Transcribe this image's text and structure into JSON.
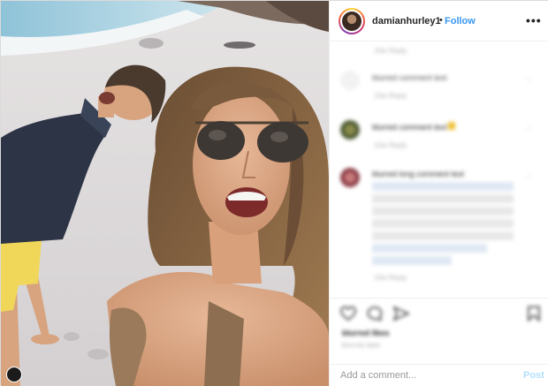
{
  "post": {
    "username": "damianhurley1",
    "separator": "•",
    "follow_label": "Follow",
    "more_label": "•••"
  },
  "comments": [
    {
      "text": "",
      "meta": "10w  Reply"
    },
    {
      "text": "blurred comment text",
      "meta": "10w  Reply"
    },
    {
      "text": "blurred comment text",
      "meta": "10w  Reply"
    },
    {
      "text": "blurred long comment text",
      "meta": "10w  Reply"
    }
  ],
  "actions": {
    "likes": "blurred likes",
    "date": "blurred date"
  },
  "comment_input": {
    "placeholder": "Add a comment...",
    "post_label": "Post"
  },
  "colors": {
    "accent": "#3897f0",
    "post_disabled": "#b2dffc",
    "border": "#efefef"
  },
  "icons": [
    "more-options-icon",
    "heart-icon",
    "comment-icon",
    "share-icon",
    "bookmark-icon"
  ]
}
